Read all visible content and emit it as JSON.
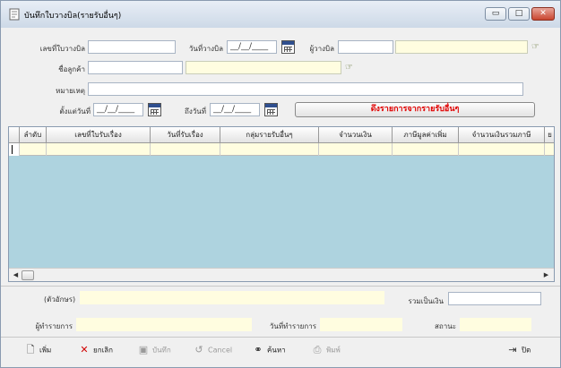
{
  "window": {
    "title": "บันทึกใบวางบิล(รายรับอื่นๆ)",
    "controls": {
      "minimize": "▭",
      "maximize": "□",
      "close": "✕"
    }
  },
  "form": {
    "bill_no_label": "เลขที่ใบวางบิล",
    "bill_date_label": "วันที่วางบิล",
    "bill_date_value": "__/__/____",
    "biller_label": "ผู้วางบิล",
    "customer_code_label": "ชื่อลูกค้า",
    "remark_label": "หมายเหตุ",
    "from_date_label": "ตั้งแต่วันที่",
    "from_date_value": "__/__/____",
    "to_date_label": "ถึงวันที่",
    "to_date_value": "__/__/____",
    "fetch_button_label": "ดึงรายการจากรายรับอื่นๆ"
  },
  "grid": {
    "columns": [
      "ลำดับ",
      "เลขที่ใบรับเรื่อง",
      "วันที่รับเรื่อง",
      "กลุ่มรายรับอื่นๆ",
      "จำนวนเงิน",
      "ภาษีมูลค่าเพิ่ม",
      "จำนวนเงินรวมภาษี",
      "ย"
    ]
  },
  "summary": {
    "amount_text_label": "(ตัวอักษร)",
    "total_label": "รวมเป็นเงิน",
    "creator_label": "ผู้ทำรายการ",
    "created_date_label": "วันที่ทำรายการ",
    "status_label": "สถานะ"
  },
  "toolbar": {
    "add": "เพิ่ม",
    "cancel_doc": "ยกเลิก",
    "save": "บันทึก",
    "cancel": "Cancel",
    "search": "ค้นหา",
    "print": "พิมพ์",
    "close": "ปิด"
  },
  "colors": {
    "grid_background": "#aed3df",
    "row_highlight": "#fffde0",
    "fetch_text": "#e00000"
  },
  "icons": {
    "add": "new-document-icon",
    "cancel_doc": "red-x-icon",
    "save": "floppy-icon",
    "cancel": "undo-icon",
    "search": "binoculars-icon",
    "print": "printer-icon",
    "close": "exit-door-icon"
  }
}
